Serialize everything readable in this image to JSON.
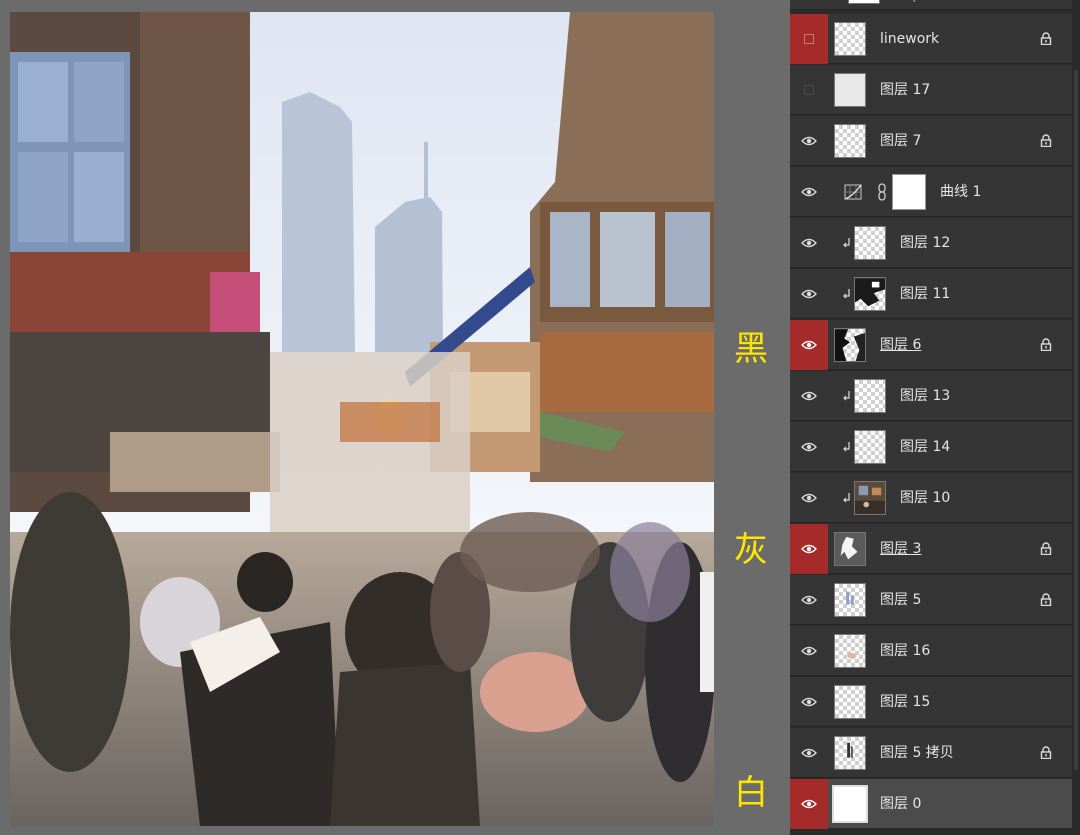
{
  "annotations": {
    "black": "黑",
    "gray": "灰",
    "white": "白"
  },
  "colors": {
    "panel_bg": "#2a2a2a",
    "row_bg": "#353535",
    "visibility_red": "#a52a2a",
    "annotation_yellow": "#ffe600"
  },
  "layers_panel": {
    "partial_top_label": "backup",
    "layers": [
      {
        "name": "linework",
        "visible": false,
        "red": true,
        "locked": true
      },
      {
        "name": "图层 17",
        "visible": false,
        "red": false,
        "locked": false
      },
      {
        "name": "图层 7",
        "visible": true,
        "red": false,
        "locked": true
      },
      {
        "name": "曲线 1",
        "visible": true,
        "red": false,
        "locked": false,
        "adjustment": true
      },
      {
        "name": "图层 12",
        "visible": true,
        "red": false,
        "locked": false,
        "clipped": true
      },
      {
        "name": "图层 11",
        "visible": true,
        "red": false,
        "locked": false,
        "clipped": true
      },
      {
        "name": "图层 6",
        "visible": true,
        "red": true,
        "locked": true
      },
      {
        "name": "图层 13",
        "visible": true,
        "red": false,
        "locked": false,
        "clipped": true
      },
      {
        "name": "图层 14",
        "visible": true,
        "red": false,
        "locked": false,
        "clipped": true
      },
      {
        "name": "图层 10",
        "visible": true,
        "red": false,
        "locked": false,
        "clipped": true
      },
      {
        "name": "图层 3",
        "visible": true,
        "red": true,
        "locked": true
      },
      {
        "name": "图层 5",
        "visible": true,
        "red": false,
        "locked": true
      },
      {
        "name": "图层 16",
        "visible": true,
        "red": false,
        "locked": false
      },
      {
        "name": "图层 15",
        "visible": true,
        "red": false,
        "locked": false
      },
      {
        "name": "图层 5 拷贝",
        "visible": true,
        "red": false,
        "locked": true
      },
      {
        "name": "图层 0",
        "visible": true,
        "red": true,
        "locked": false,
        "selected": true
      }
    ]
  }
}
